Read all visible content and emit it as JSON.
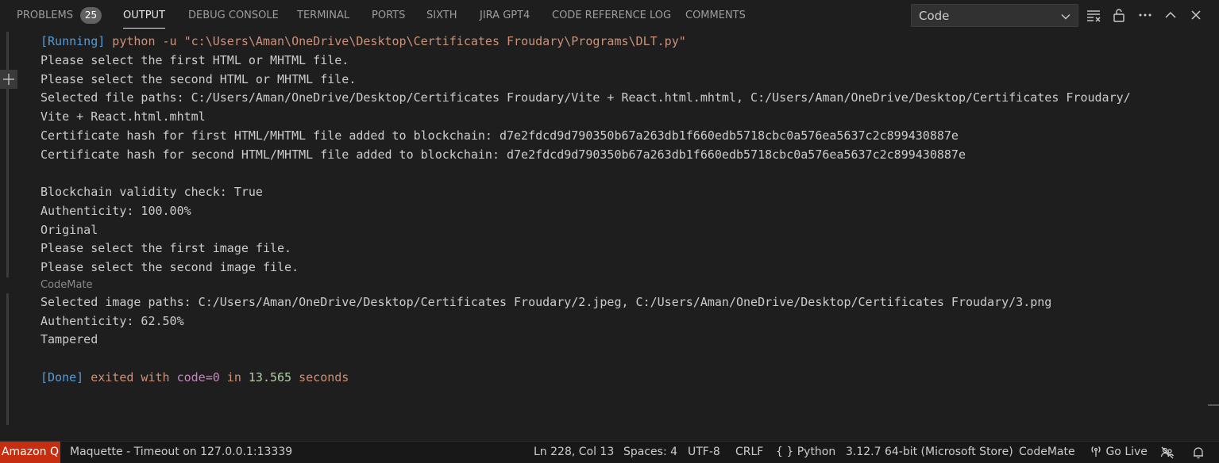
{
  "tabs": [
    {
      "label": "PROBLEMS",
      "badge": "25"
    },
    {
      "label": "OUTPUT"
    },
    {
      "label": "DEBUG CONSOLE"
    },
    {
      "label": "TERMINAL"
    },
    {
      "label": "PORTS"
    },
    {
      "label": "SIXTH"
    },
    {
      "label": "JIRA GPT4"
    },
    {
      "label": "CODE REFERENCE LOG"
    },
    {
      "label": "COMMENTS"
    }
  ],
  "active_tab": "OUTPUT",
  "channel_select": {
    "value": "Code"
  },
  "toolbar_icons": [
    "list-filter-icon",
    "lock-icon",
    "more-icon",
    "chevron-up-icon",
    "close-icon"
  ],
  "output": {
    "running_tag": "[Running]",
    "command": " python -u \"c:\\Users\\Aman\\OneDrive\\Desktop\\Certificates Froudary\\Programs\\DLT.py\"",
    "lines": [
      "Please select the first HTML or MHTML file.",
      "Please select the second HTML or MHTML file.",
      "Selected file paths: C:/Users/Aman/OneDrive/Desktop/Certificates Froudary/Vite + React.html.mhtml, C:/Users/Aman/OneDrive/Desktop/Certificates Froudary/",
      "Vite + React.html.mhtml",
      "Certificate hash for first HTML/MHTML file added to blockchain: d7e2fdcd9d790350b67a263db1f660edb5718cbc0a576ea5637c2c899430887e",
      "Certificate hash for second HTML/MHTML file added to blockchain: d7e2fdcd9d790350b67a263db1f660edb5718cbc0a576ea5637c2c899430887e",
      "",
      "Blockchain validity check: True",
      "Authenticity: 100.00%",
      "Original",
      "Please select the first image file.",
      "Please select the second image file."
    ],
    "codemate_label": "CodeMate",
    "lines_after": [
      "Selected image paths: C:/Users/Aman/OneDrive/Desktop/Certificates Froudary/2.jpeg, C:/Users/Aman/OneDrive/Desktop/Certificates Froudary/3.png",
      "Authenticity: 62.50%",
      "Tampered"
    ],
    "done": {
      "tag": "[Done]",
      "text1": " exited with ",
      "code": "code=0",
      "text2": " in ",
      "seconds": "13.565",
      "text3": " seconds"
    }
  },
  "statusbar": {
    "amazon_q": "Amazon Q",
    "maquette": "Maquette - Timeout on 127.0.0.1:13339",
    "position": "Ln 228, Col 13",
    "spaces": "Spaces: 4",
    "encoding": "UTF-8",
    "eol": "CRLF",
    "language_braces": "{ }",
    "language": "Python",
    "interpreter": "3.12.7 64-bit (Microsoft Store)",
    "codemate": "CodeMate",
    "go_live": "Go Live"
  },
  "colors": {
    "background": "#1e1e1e",
    "statusbar": "#181818",
    "amazon_q": "#c72e0f",
    "running_tag": "#569cd6",
    "command": "#ce9178",
    "code_keyword": "#c586c0",
    "number": "#b5cea8"
  }
}
